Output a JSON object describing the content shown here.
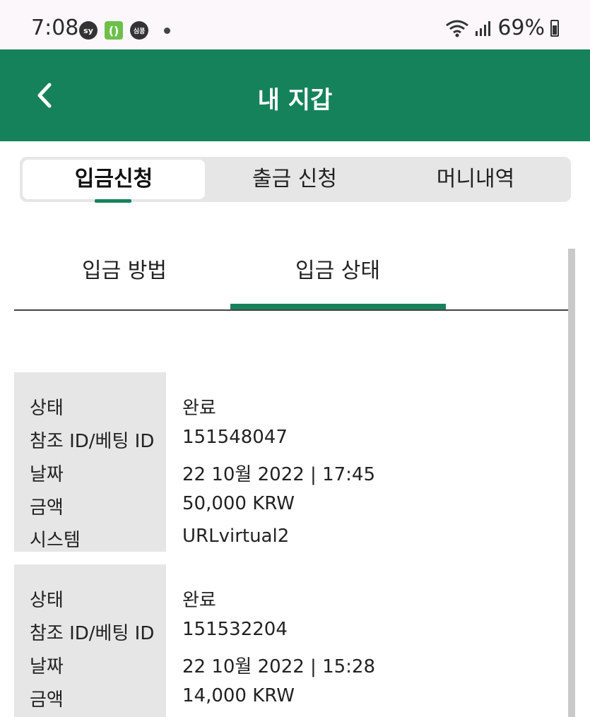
{
  "status_bar": {
    "time": "7:08",
    "notif_icons": [
      "sy",
      "()",
      "심콩"
    ],
    "battery": "69%"
  },
  "header": {
    "title": "내 지갑"
  },
  "segment_tabs": [
    {
      "label": "입금신청",
      "active": true
    },
    {
      "label": "출금 신청",
      "active": false
    },
    {
      "label": "머니내역",
      "active": false
    }
  ],
  "inner_tabs": [
    {
      "label": "입금 방법",
      "active": false
    },
    {
      "label": "입금 상태",
      "active": true
    }
  ],
  "records": [
    {
      "rows": [
        {
          "label": "상태",
          "value": "완료"
        },
        {
          "label": "참조 ID/베팅 ID",
          "value": "151548047"
        },
        {
          "label": "날짜",
          "value": "22 10월 2022 | 17:45"
        },
        {
          "label": "금액",
          "value": "50,000 KRW"
        },
        {
          "label": "시스템",
          "value": "URLvirtual2"
        }
      ]
    },
    {
      "rows": [
        {
          "label": "상태",
          "value": "완료"
        },
        {
          "label": "참조 ID/베팅 ID",
          "value": "151532204"
        },
        {
          "label": "날짜",
          "value": "22 10월 2022 | 15:28"
        },
        {
          "label": "금액",
          "value": "14,000 KRW"
        }
      ]
    }
  ],
  "colors": {
    "brand": "#16825c",
    "label_bg": "#e6e6e6"
  }
}
